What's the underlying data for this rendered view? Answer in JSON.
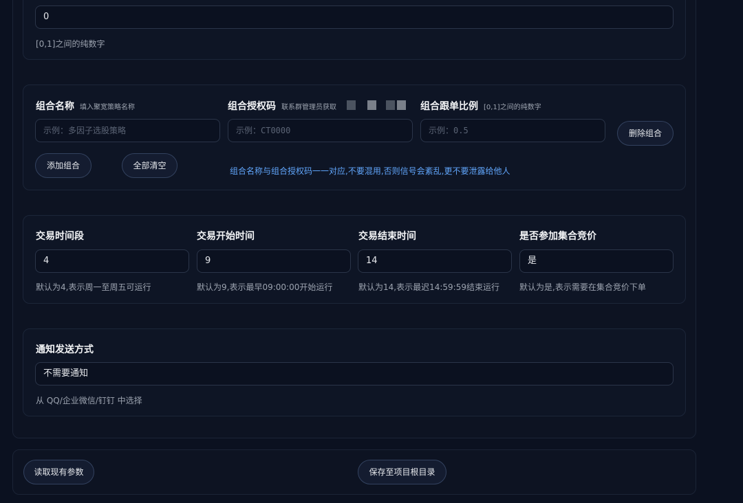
{
  "top_field": {
    "value": "0",
    "hint": "[0,1]之间的纯数字"
  },
  "group": {
    "name_label": "组合名称",
    "name_sublabel": "填入聚宽策略名称",
    "name_placeholder": "示例：多因子选股策略",
    "auth_label": "组合授权码",
    "auth_sublabel": "联系群管理员获取",
    "auth_placeholder": "示例：CT0000",
    "ratio_label": "组合跟单比例",
    "ratio_sublabel": "[0,1]之间的纯数字",
    "ratio_placeholder": "示例：0.5",
    "delete_button": "删除组合",
    "add_button": "添加组合",
    "clear_button": "全部清空",
    "notice": "组合名称与组合授权码一一对应,不要混用,否则信号会紊乱,更不要泄露给他人"
  },
  "trading": {
    "period": {
      "label": "交易时间段",
      "value": "4",
      "hint": "默认为4,表示周一至周五可运行"
    },
    "start": {
      "label": "交易开始时间",
      "value": "9",
      "hint": "默认为9,表示最早09:00:00开始运行"
    },
    "end": {
      "label": "交易结束时间",
      "value": "14",
      "hint": "默认为14,表示最迟14:59:59结束运行"
    },
    "auction": {
      "label": "是否参加集合竞价",
      "value": "是",
      "hint": "默认为是,表示需要在集合竞价下单"
    }
  },
  "notification": {
    "label": "通知发送方式",
    "value": "不需要通知",
    "hint": "从 QQ/企业微信/钉钉 中选择"
  },
  "footer": {
    "read_button": "读取现有参数",
    "save_button": "保存至项目根目录"
  }
}
